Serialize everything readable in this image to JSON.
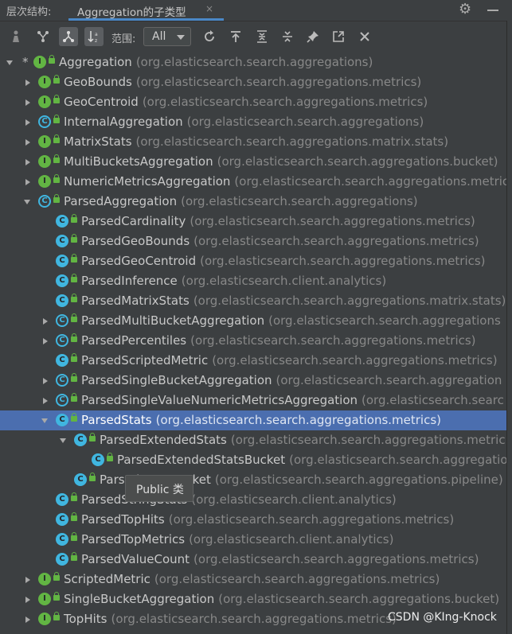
{
  "panel": {
    "label": "层次结构:",
    "tab_title": "Aggregation的子类型",
    "tab_close": "×",
    "settings_icon": "gear-icon",
    "minimize_icon": "minus-icon"
  },
  "toolbar": {
    "buttons": [
      {
        "name": "supertypes-hierarchy-button",
        "icon": "person-up-icon",
        "active": false
      },
      {
        "name": "subtypes-hierarchy-button",
        "icon": "branch-down-icon",
        "active": false
      },
      {
        "name": "class-hierarchy-button",
        "icon": "branch-icon",
        "active": true
      },
      {
        "name": "sort-alphabetically-button",
        "icon": "sort-az-icon",
        "active": true
      },
      {
        "name": "refresh-button",
        "icon": "refresh-icon",
        "active": false
      },
      {
        "name": "export-button",
        "icon": "export-icon",
        "active": false
      },
      {
        "name": "expand-all-button",
        "icon": "expand-icon",
        "active": false
      },
      {
        "name": "collapse-all-button",
        "icon": "collapse-icon",
        "active": false
      },
      {
        "name": "pin-button",
        "icon": "pin-icon",
        "active": false
      },
      {
        "name": "open-in-editor-button",
        "icon": "open-icon",
        "active": false
      },
      {
        "name": "close-button",
        "icon": "close-icon",
        "active": false
      }
    ],
    "scope_label": "范围:",
    "scope_value": "All"
  },
  "tree": [
    {
      "level": 0,
      "arrow": "down",
      "star": true,
      "icon": "i",
      "lock": true,
      "name": "Aggregation",
      "pkg": "(org.elasticsearch.search.aggregations)"
    },
    {
      "level": 1,
      "arrow": "right",
      "icon": "i",
      "lock": true,
      "name": "GeoBounds",
      "pkg": "(org.elasticsearch.search.aggregations.metrics)"
    },
    {
      "level": 1,
      "arrow": "right",
      "icon": "i",
      "lock": true,
      "name": "GeoCentroid",
      "pkg": "(org.elasticsearch.search.aggregations.metrics)"
    },
    {
      "level": 1,
      "arrow": "right",
      "icon": "ac",
      "lock": true,
      "name": "InternalAggregation",
      "pkg": "(org.elasticsearch.search.aggregations)"
    },
    {
      "level": 1,
      "arrow": "right",
      "icon": "i",
      "lock": true,
      "name": "MatrixStats",
      "pkg": "(org.elasticsearch.search.aggregations.matrix.stats)"
    },
    {
      "level": 1,
      "arrow": "right",
      "icon": "i",
      "lock": true,
      "name": "MultiBucketsAggregation",
      "pkg": "(org.elasticsearch.search.aggregations.bucket)"
    },
    {
      "level": 1,
      "arrow": "right",
      "icon": "i",
      "lock": true,
      "name": "NumericMetricsAggregation",
      "pkg": "(org.elasticsearch.search.aggregations.metrics)"
    },
    {
      "level": 1,
      "arrow": "down",
      "icon": "ac",
      "lock": true,
      "name": "ParsedAggregation",
      "pkg": "(org.elasticsearch.search.aggregations)"
    },
    {
      "level": 2,
      "arrow": "none",
      "icon": "c",
      "lock": true,
      "name": "ParsedCardinality",
      "pkg": "(org.elasticsearch.search.aggregations.metrics)"
    },
    {
      "level": 2,
      "arrow": "none",
      "icon": "c",
      "lock": true,
      "name": "ParsedGeoBounds",
      "pkg": "(org.elasticsearch.search.aggregations.metrics)"
    },
    {
      "level": 2,
      "arrow": "none",
      "icon": "c",
      "lock": true,
      "name": "ParsedGeoCentroid",
      "pkg": "(org.elasticsearch.search.aggregations.metrics)"
    },
    {
      "level": 2,
      "arrow": "none",
      "icon": "c",
      "lock": true,
      "name": "ParsedInference",
      "pkg": "(org.elasticsearch.client.analytics)"
    },
    {
      "level": 2,
      "arrow": "none",
      "icon": "c",
      "lock": true,
      "name": "ParsedMatrixStats",
      "pkg": "(org.elasticsearch.search.aggregations.matrix.stats)"
    },
    {
      "level": 2,
      "arrow": "right",
      "icon": "ac",
      "lock": true,
      "name": "ParsedMultiBucketAggregation",
      "pkg": "(org.elasticsearch.search.aggregations"
    },
    {
      "level": 2,
      "arrow": "right",
      "icon": "ac",
      "lock": true,
      "name": "ParsedPercentiles",
      "pkg": "(org.elasticsearch.search.aggregations.metrics)"
    },
    {
      "level": 2,
      "arrow": "none",
      "icon": "c",
      "lock": true,
      "name": "ParsedScriptedMetric",
      "pkg": "(org.elasticsearch.search.aggregations.metrics)"
    },
    {
      "level": 2,
      "arrow": "right",
      "icon": "ac",
      "lock": true,
      "name": "ParsedSingleBucketAggregation",
      "pkg": "(org.elasticsearch.search.aggregation"
    },
    {
      "level": 2,
      "arrow": "right",
      "icon": "ac",
      "lock": true,
      "name": "ParsedSingleValueNumericMetricsAggregation",
      "pkg": "(org.elasticsearch.searc"
    },
    {
      "level": 2,
      "arrow": "down",
      "icon": "c",
      "lock": true,
      "name": "ParsedStats",
      "pkg": "(org.elasticsearch.search.aggregations.metrics)",
      "selected": true
    },
    {
      "level": 3,
      "arrow": "down",
      "icon": "c",
      "lock": true,
      "name": "ParsedExtendedStats",
      "pkg": "(org.elasticsearch.search.aggregations.metric"
    },
    {
      "level": 4,
      "arrow": "none",
      "icon": "c",
      "lock": true,
      "name": "ParsedExtendedStatsBucket",
      "pkg": "(org.elasticsearch.search.aggregation"
    },
    {
      "level": 3,
      "arrow": "none",
      "icon": "c",
      "lock": true,
      "name": "ParsedStatsBucket",
      "pkg": "(org.elasticsearch.search.aggregations.pipeline)"
    },
    {
      "level": 2,
      "arrow": "none",
      "icon": "c",
      "lock": true,
      "name": "ParsedStringStats",
      "pkg": "(org.elasticsearch.client.analytics)"
    },
    {
      "level": 2,
      "arrow": "none",
      "icon": "c",
      "lock": true,
      "name": "ParsedTopHits",
      "pkg": "(org.elasticsearch.search.aggregations.metrics)"
    },
    {
      "level": 2,
      "arrow": "none",
      "icon": "c",
      "lock": true,
      "name": "ParsedTopMetrics",
      "pkg": "(org.elasticsearch.client.analytics)"
    },
    {
      "level": 2,
      "arrow": "none",
      "icon": "c",
      "lock": true,
      "name": "ParsedValueCount",
      "pkg": "(org.elasticsearch.search.aggregations.metrics)"
    },
    {
      "level": 1,
      "arrow": "right",
      "icon": "i",
      "lock": true,
      "name": "ScriptedMetric",
      "pkg": "(org.elasticsearch.search.aggregations.metrics)"
    },
    {
      "level": 1,
      "arrow": "right",
      "icon": "i",
      "lock": true,
      "name": "SingleBucketAggregation",
      "pkg": "(org.elasticsearch.search.aggregations.bucket)"
    },
    {
      "level": 1,
      "arrow": "right",
      "icon": "i",
      "lock": true,
      "name": "TopHits",
      "pkg": "(org.elasticsearch.search.aggregations.metrics)"
    }
  ],
  "tooltip": "Public 类",
  "watermark": "CSDN @KIng-Knock",
  "colors": {
    "background": "#3c3f41",
    "selection": "#4b6eaf",
    "interface_icon": "#62b543",
    "class_icon": "#40b6e0",
    "package_text": "#888888",
    "tab_underline": "#4a88c7"
  }
}
